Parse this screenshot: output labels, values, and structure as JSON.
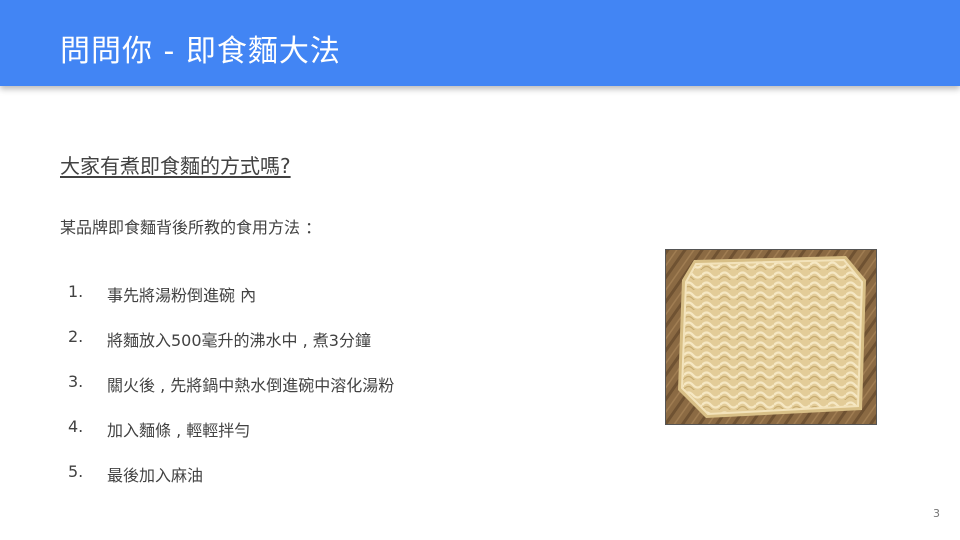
{
  "slide": {
    "title": "問問你 - 即食麵大法",
    "question": "大家有煮即食麵的方式嗎?",
    "intro": "某品牌即食麵背後所教的食用方法 ：",
    "steps": [
      {
        "num": "1.",
        "text": "事先將湯粉倒進碗 內"
      },
      {
        "num": "2.",
        "text": "將麵放入500毫升的沸水中 , 煮3分鐘"
      },
      {
        "num": "3.",
        "text": "關火後 , 先將鍋中熱水倒進碗中溶化湯粉"
      },
      {
        "num": "4.",
        "text": "加入麵條 , 輕輕拌勻"
      },
      {
        "num": "5.",
        "text": "最後加入麻油"
      }
    ],
    "page_number": "3"
  },
  "colors": {
    "header": "#4285f4",
    "text": "#424242",
    "noodle": "#e8d4a6",
    "wood": "#8b6a43"
  }
}
